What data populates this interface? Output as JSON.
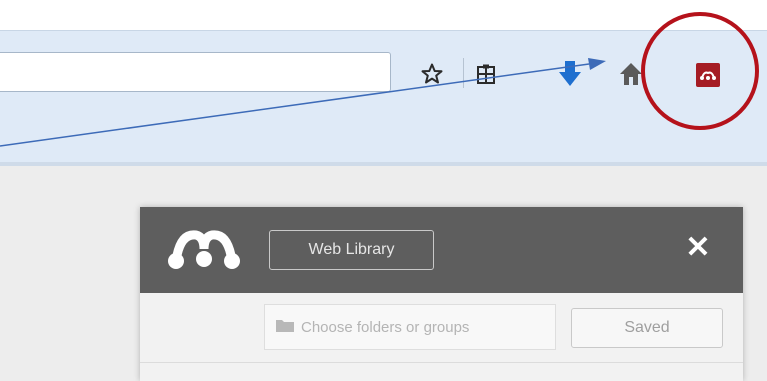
{
  "popup": {
    "web_library_label": "Web Library",
    "close_label": "✕",
    "folder_placeholder": "Choose folders or groups",
    "saved_label": "Saved"
  },
  "colors": {
    "toolbar_bg": "#dfeaf7",
    "popup_header_bg": "#5e5e5e",
    "extension_accent": "#a51c24",
    "highlight_ring": "#b5121b",
    "arrow": "#3d6bb8"
  },
  "icons": [
    "star-icon",
    "clipboard-icon",
    "download-icon",
    "home-icon",
    "mendeley-icon",
    "mendeley-logo",
    "folder-icon",
    "close-icon"
  ]
}
